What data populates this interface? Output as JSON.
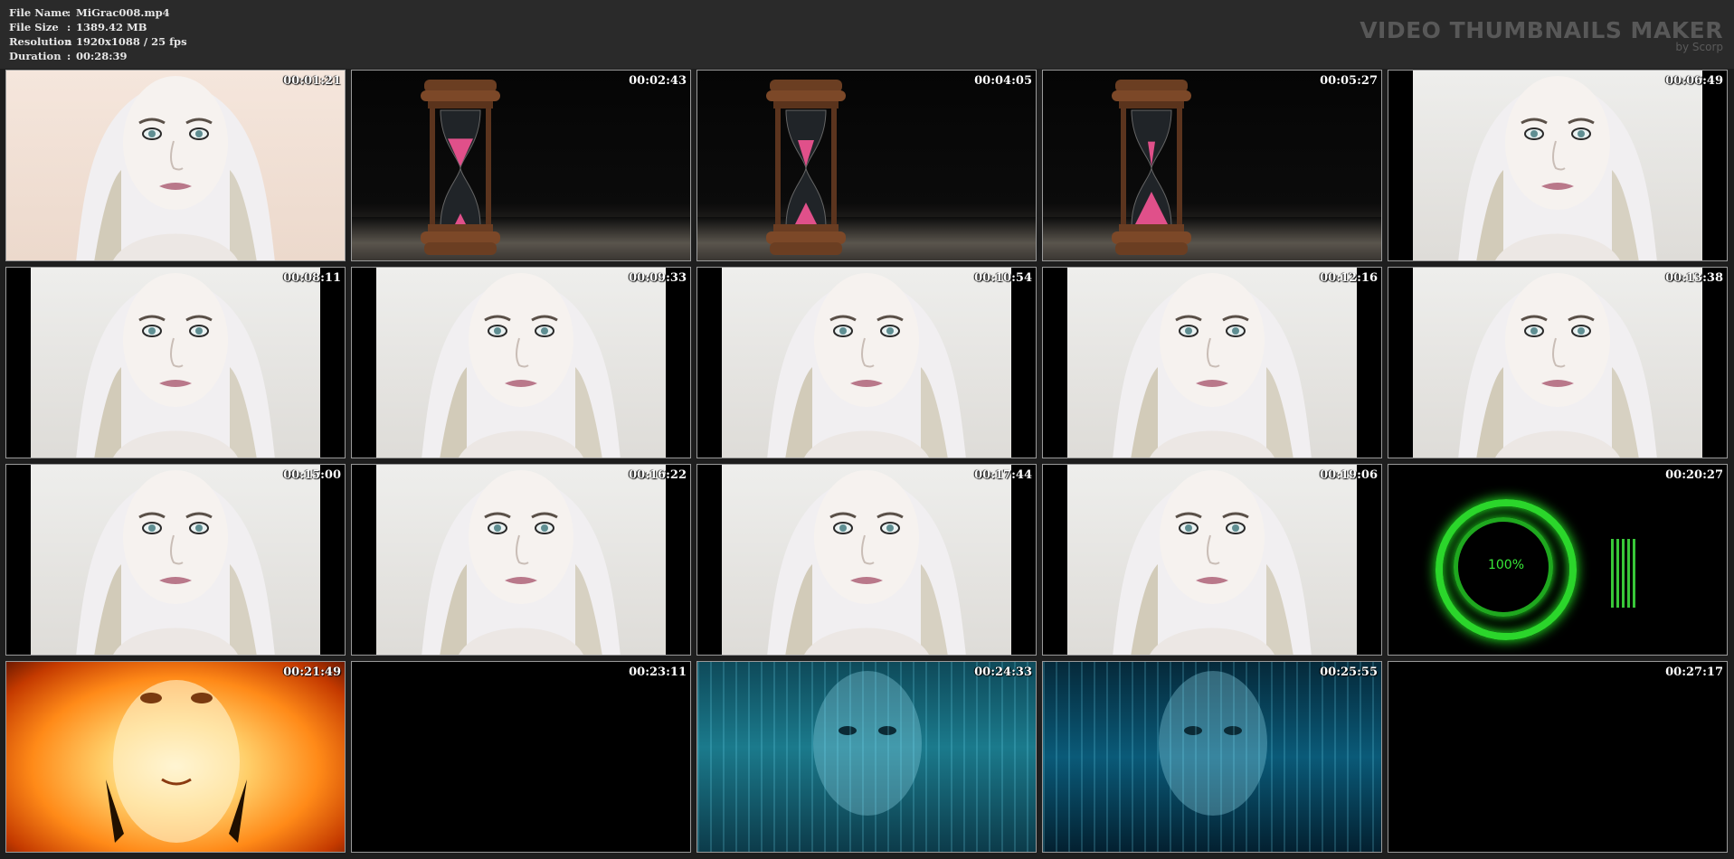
{
  "file_info": {
    "rows": [
      {
        "key": "File Name",
        "sep": ":",
        "value": "MiGrac008.mp4"
      },
      {
        "key": "File Size",
        "sep": ":",
        "value": "1389.42 MB"
      },
      {
        "key": "Resolution",
        "sep": ":",
        "value": "1920x1088 / 25 fps"
      },
      {
        "key": "Duration",
        "sep": ":",
        "value": "00:28:39"
      }
    ]
  },
  "brand": {
    "title": "VIDEO THUMBNAILS MAKER",
    "subtitle": "by Scorp"
  },
  "thumbnails": [
    {
      "time": "00:01:21",
      "scene": "face-full"
    },
    {
      "time": "00:02:43",
      "scene": "hourglass"
    },
    {
      "time": "00:04:05",
      "scene": "hourglass"
    },
    {
      "time": "00:05:27",
      "scene": "hourglass"
    },
    {
      "time": "00:06:49",
      "scene": "face-pillar"
    },
    {
      "time": "00:08:11",
      "scene": "face-pillar"
    },
    {
      "time": "00:09:33",
      "scene": "face-pillar"
    },
    {
      "time": "00:10:54",
      "scene": "face-pillar"
    },
    {
      "time": "00:12:16",
      "scene": "face-pillar"
    },
    {
      "time": "00:13:38",
      "scene": "face-pillar"
    },
    {
      "time": "00:15:00",
      "scene": "face-pillar"
    },
    {
      "time": "00:16:22",
      "scene": "face-pillar"
    },
    {
      "time": "00:17:44",
      "scene": "face-pillar"
    },
    {
      "time": "00:19:06",
      "scene": "face-pillar"
    },
    {
      "time": "00:20:27",
      "scene": "loader",
      "overlay_text": "100%"
    },
    {
      "time": "00:21:49",
      "scene": "fire"
    },
    {
      "time": "00:23:11",
      "scene": "black"
    },
    {
      "time": "00:24:33",
      "scene": "matrix"
    },
    {
      "time": "00:25:55",
      "scene": "matrix"
    },
    {
      "time": "00:27:17",
      "scene": "black"
    }
  ],
  "colors": {
    "header_bg": "#2a2a2a",
    "page_bg": "#1e1e1e",
    "loader_green": "#2bd62b",
    "brand_gray": "#585858"
  }
}
